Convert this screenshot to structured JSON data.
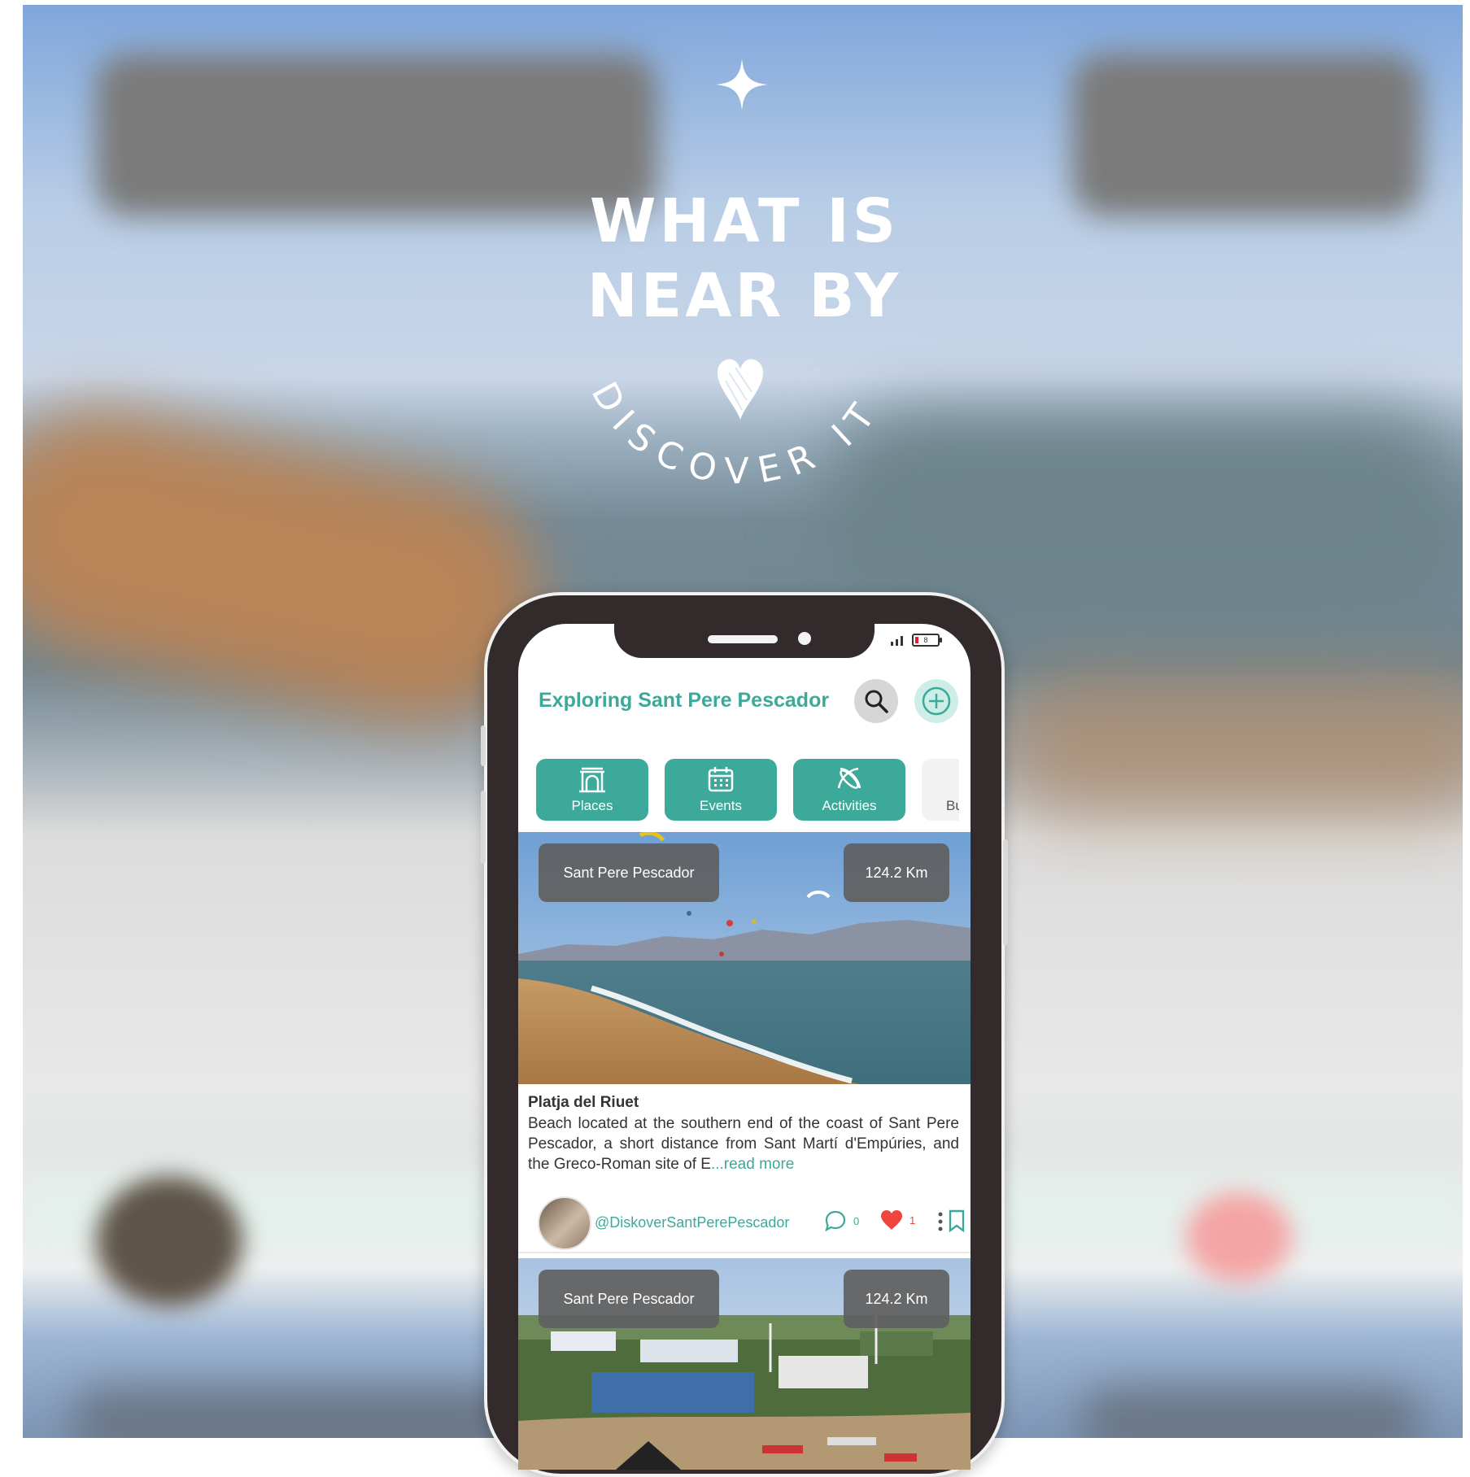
{
  "poster": {
    "headline": [
      "WHAT IS",
      "NEAR BY"
    ],
    "arc_text": "DISCOVER IT"
  },
  "status_bar": {
    "battery": "8"
  },
  "app": {
    "title": "Exploring Sant Pere Pescador",
    "accent_color": "#3ca99a"
  },
  "categories": [
    {
      "label": "Places",
      "icon": "landmark-icon"
    },
    {
      "label": "Events",
      "icon": "calendar-icon"
    },
    {
      "label": "Activities",
      "icon": "kitesurf-icon"
    },
    {
      "label": "Bu",
      "icon": ""
    }
  ],
  "cards": [
    {
      "location": "Sant Pere Pescador",
      "distance": "124.2 Km",
      "title": "Platja del Riuet",
      "description": "Beach located at the southern end of the coast of Sant Pere Pescador, a short distance from Sant Martí d'Empúries, and the Greco-Roman site of E",
      "read_more": "...read more",
      "user": "@DiskoverSantPerePescador",
      "comments": "0",
      "likes": "1"
    },
    {
      "location": "Sant Pere Pescador",
      "distance": "124.2 Km"
    }
  ]
}
